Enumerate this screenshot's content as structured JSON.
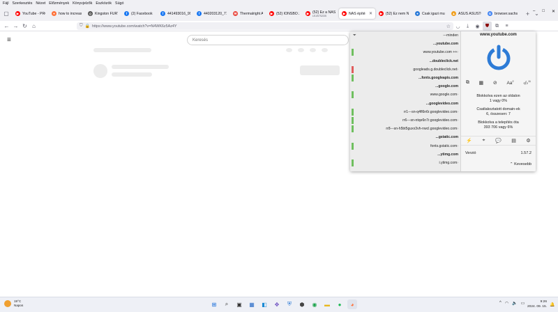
{
  "menu": [
    "Fájl",
    "Szerkesztés",
    "Nézet",
    "Előzmények",
    "Könyvjelzők",
    "Eszközök",
    "Súgó"
  ],
  "window_controls": {
    "minimize": "–",
    "maximize": "□",
    "close": "✕"
  },
  "tabs": [
    {
      "label": "YouTube - PROM",
      "icon": "youtube-icon",
      "color": "#ff0000",
      "active": false
    },
    {
      "label": "how to increase",
      "icon": "firefox-icon",
      "color": "#ff7139",
      "active": false
    },
    {
      "label": "Kingston FURY",
      "icon": "tag-icon",
      "color": "#555555",
      "active": false
    },
    {
      "label": "(2) Facebook",
      "icon": "facebook-icon",
      "color": "#1877f2",
      "active": false
    },
    {
      "label": "441493016_9939",
      "icon": "facebook-icon",
      "color": "#1877f2",
      "active": false
    },
    {
      "label": "440203120_7727",
      "icon": "facebook-icon",
      "color": "#1877f2",
      "active": false
    },
    {
      "label": "Thermalright Ar",
      "icon": "mail-icon",
      "color": "#e8453c",
      "active": false
    },
    {
      "label": "(52) IONSBO Z20",
      "icon": "youtube-icon",
      "color": "#ff0000",
      "active": false
    },
    {
      "label": "(52) Ez a NAS Ér",
      "sub": "LEJÁTSZÁS",
      "icon": "youtube-icon",
      "color": "#ff0000",
      "active": false
    },
    {
      "label": "NAS építés",
      "icon": "youtube-icon",
      "color": "#ff0000",
      "active": true
    },
    {
      "label": "(52) Ez nem NAS",
      "icon": "youtube-icon",
      "color": "#ff0000",
      "active": false
    },
    {
      "label": "Csak igazi mun",
      "icon": "circle-icon",
      "color": "#2a7ad8",
      "active": false
    },
    {
      "label": "ASUS ASUSTOR",
      "icon": "warning-icon",
      "color": "#f0a020",
      "active": false
    },
    {
      "label": "browser.sachs",
      "icon": "google-icon",
      "color": "#4285f4",
      "active": false
    }
  ],
  "tab_add": "+",
  "tab_list": "⌄",
  "url": "https://www.youtube.com/watch?v=N4WK6z5Az4Y",
  "search_placeholder": "Keresés",
  "panel": {
    "filter_label": "minden",
    "rows": [
      {
        "text": "youtube.com",
        "bold": true,
        "bar": "none"
      },
      {
        "text": "www.youtube.com ++",
        "bold": false,
        "bar": "#6fbf5f"
      },
      {
        "text": "doubleclick.net",
        "bold": true,
        "bar": "none"
      },
      {
        "text": "googleads.g.doubleclick.net",
        "bold": false,
        "bar": "#e05c5c"
      },
      {
        "text": "fonts.googleapis.com",
        "bold": true,
        "bar": "#6fbf5f"
      },
      {
        "text": "google.com",
        "bold": true,
        "bar": "none"
      },
      {
        "text": "www.google.com",
        "bold": false,
        "bar": "#6fbf5f"
      },
      {
        "text": "googlevideo.com",
        "bold": true,
        "bar": "none"
      },
      {
        "text": "rr1---sn-q4fl6n6r.googlevideo.com",
        "bold": false,
        "bar": "#6fbf5f"
      },
      {
        "text": "rr6---sn-ntqe6n7r.googlevideo.com",
        "bold": false,
        "bar": "#6fbf5f"
      },
      {
        "text": "rr8---sn-h5bt5guxx3vh-nwcl.googlevideo.com",
        "bold": false,
        "bar": "#6fbf5f"
      },
      {
        "text": "gstatic.com",
        "bold": true,
        "bar": "none"
      },
      {
        "text": "fonts.gstatic.com",
        "bold": false,
        "bar": "#6fbf5f"
      },
      {
        "text": "ytimg.com",
        "bold": true,
        "bar": "none"
      },
      {
        "text": "i.ytimg.com",
        "bold": false,
        "bar": "#6fbf5f"
      }
    ],
    "domain": "www.youtube.com",
    "blocked_page_label": "Blokkolva ezen az oldalon",
    "blocked_page_value": "1 vagy 0%",
    "connected_label": "Csatlakoztatott domain-ek",
    "connected_value": "6, összesen: 7",
    "blocked_install_label": "Blokkolva a telepítés óta",
    "blocked_install_value": "393 706 vagy 6%",
    "version_label": "Verzió",
    "version_value": "1.57.2",
    "less_label": "Kevesebb",
    "font_icon_text": "Aa",
    "accent": "#2d7bd6"
  },
  "weather": {
    "temp": "19°C",
    "desc": "Napos"
  },
  "clock": {
    "time": "9:26",
    "date": "2024. 09. 15."
  },
  "tray_lang": "^"
}
